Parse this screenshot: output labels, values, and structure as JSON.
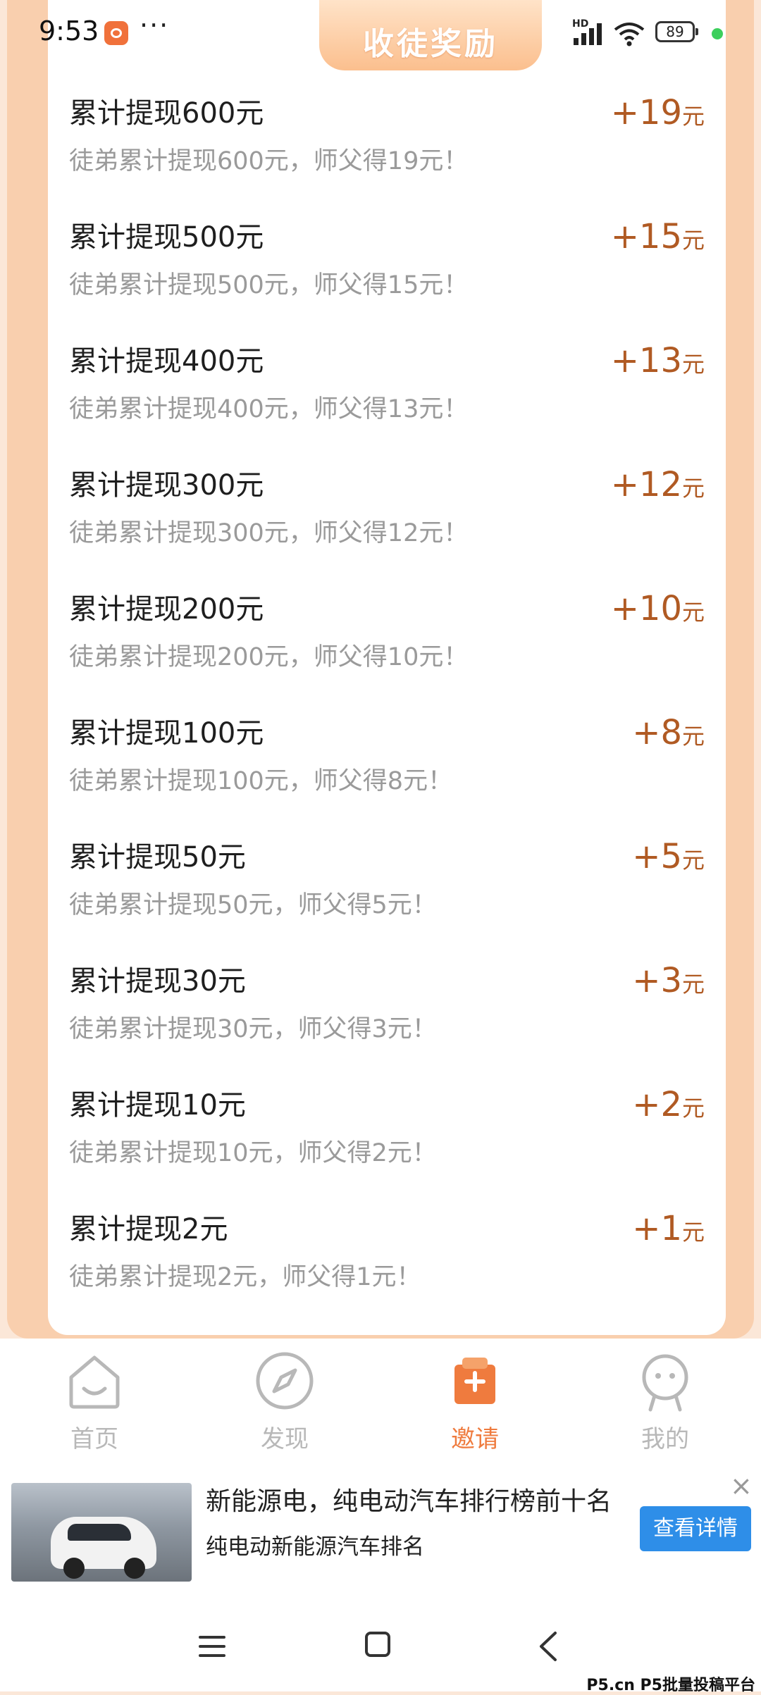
{
  "status_bar": {
    "time": "9:53",
    "dots": "···",
    "network_label": "HD",
    "battery": "89"
  },
  "header": {
    "title": "收徒奖励"
  },
  "rewards": [
    {
      "title": "累计提现600元",
      "desc": "徒弟累计提现600元，师父得19元！",
      "amount": "+19",
      "unit": "元"
    },
    {
      "title": "累计提现500元",
      "desc": "徒弟累计提现500元，师父得15元！",
      "amount": "+15",
      "unit": "元"
    },
    {
      "title": "累计提现400元",
      "desc": "徒弟累计提现400元，师父得13元！",
      "amount": "+13",
      "unit": "元"
    },
    {
      "title": "累计提现300元",
      "desc": "徒弟累计提现300元，师父得12元！",
      "amount": "+12",
      "unit": "元"
    },
    {
      "title": "累计提现200元",
      "desc": "徒弟累计提现200元，师父得10元！",
      "amount": "+10",
      "unit": "元"
    },
    {
      "title": "累计提现100元",
      "desc": "徒弟累计提现100元，师父得8元！",
      "amount": "+8",
      "unit": "元"
    },
    {
      "title": "累计提现50元",
      "desc": "徒弟累计提现50元，师父得5元！",
      "amount": "+5",
      "unit": "元"
    },
    {
      "title": "累计提现30元",
      "desc": "徒弟累计提现30元，师父得3元！",
      "amount": "+3",
      "unit": "元"
    },
    {
      "title": "累计提现10元",
      "desc": "徒弟累计提现10元，师父得2元！",
      "amount": "+2",
      "unit": "元"
    },
    {
      "title": "累计提现2元",
      "desc": "徒弟累计提现2元，师父得1元！",
      "amount": "+1",
      "unit": "元"
    }
  ],
  "bottom_nav": [
    {
      "label": "首页",
      "icon": "home-icon",
      "active": false
    },
    {
      "label": "发现",
      "icon": "compass-icon",
      "active": false
    },
    {
      "label": "邀请",
      "icon": "invite-icon",
      "active": true
    },
    {
      "label": "我的",
      "icon": "profile-icon",
      "active": false
    }
  ],
  "ad": {
    "title": "新能源电，纯电动汽车排行榜前十名",
    "subtitle": "纯电动新能源汽车排名",
    "button": "查看详情",
    "close": "×"
  },
  "watermark": "P5.cn P5批量投稿平台",
  "colors": {
    "accent": "#ef7b3e",
    "amount": "#b05a23",
    "frame": "#f9cfae",
    "button": "#2e8ee8"
  }
}
